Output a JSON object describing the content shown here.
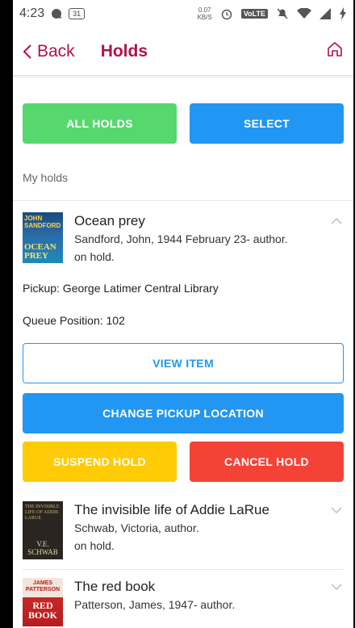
{
  "status_bar": {
    "time": "4:23",
    "calendar_day": "31",
    "speed_top": "0.07",
    "speed_bottom": "KB/S",
    "volte": "VoLTE"
  },
  "header": {
    "back_label": "Back",
    "title": "Holds",
    "accent_color": "#b0124a"
  },
  "actions": {
    "all_holds": "ALL HOLDS",
    "select": "SELECT"
  },
  "section_label": "My holds",
  "holds": [
    {
      "title": "Ocean prey",
      "author": "Sandford, John, 1944 February 23- author.",
      "status": "on hold.",
      "cover_text_top": "JOHN SANDFORD",
      "cover_text_main": "OCEAN PREY",
      "expanded": true,
      "pickup": "Pickup: George Latimer Central Library",
      "queue": "Queue Position: 102",
      "view_item": "VIEW ITEM",
      "change_pickup": "CHANGE PICKUP LOCATION",
      "suspend": "SUSPEND HOLD",
      "cancel": "CANCEL HOLD"
    },
    {
      "title": "The invisible life of Addie LaRue",
      "author": "Schwab, Victoria, author.",
      "status": "on hold.",
      "cover_text_top": "THE INVISIBLE LIFE OF ADDIE LARUE",
      "cover_text_main": "V.E. SCHWAB",
      "expanded": false
    },
    {
      "title": "The red book",
      "author": "Patterson, James, 1947- author.",
      "status": "",
      "cover_text_top": "JAMES PATTERSON",
      "cover_text_main": "RED BOOK",
      "expanded": false
    }
  ],
  "colors": {
    "green": "#56d86e",
    "blue": "#2196f3",
    "yellow": "#ffcb05",
    "red": "#f44336"
  }
}
